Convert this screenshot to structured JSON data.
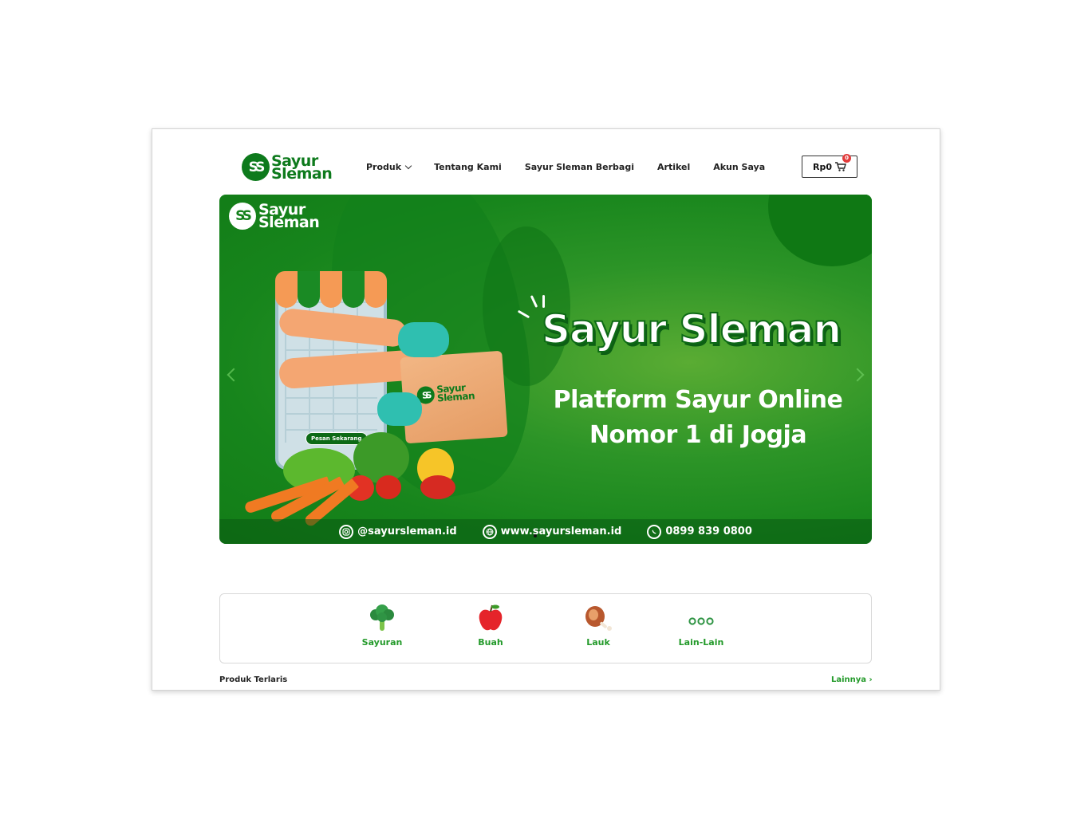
{
  "header": {
    "logo_mark": "SS",
    "logo_line1": "Sayur",
    "logo_line2": "Sleman",
    "nav": [
      {
        "label": "Produk",
        "has_dropdown": true
      },
      {
        "label": "Tentang Kami"
      },
      {
        "label": "Sayur Sleman Berbagi"
      },
      {
        "label": "Artikel"
      },
      {
        "label": "Akun Saya"
      }
    ],
    "cart_total": "Rp0",
    "cart_count": "0",
    "cart_icon": "cart-icon"
  },
  "banner": {
    "logo_mark": "SS",
    "logo_line1": "Sayur",
    "logo_line2": "Sleman",
    "title": "Sayur Sleman",
    "subtitle_line1": "Platform Sayur Online",
    "subtitle_line2": "Nomor 1 di Jogja",
    "bag_logo_line1": "Sayur",
    "bag_logo_line2": "Sleman",
    "cta": "Pesan Sekarang",
    "contacts": [
      {
        "icon": "instagram-icon",
        "text": "@sayursleman.id"
      },
      {
        "icon": "globe-icon",
        "text": "www.sayursleman.id"
      },
      {
        "icon": "whatsapp-icon",
        "text": "0899 839 0800"
      }
    ],
    "colors": {
      "primary": "#0d7a1c",
      "accent": "#5aac33"
    }
  },
  "categories": [
    {
      "label": "Sayuran",
      "icon": "broccoli-icon"
    },
    {
      "label": "Buah",
      "icon": "apple-icon"
    },
    {
      "label": "Lauk",
      "icon": "meat-icon"
    },
    {
      "label": "Lain-Lain",
      "icon": "more-icon"
    }
  ],
  "products": {
    "section_title": "Produk Terlaris",
    "more_label": "Lainnya ›"
  }
}
